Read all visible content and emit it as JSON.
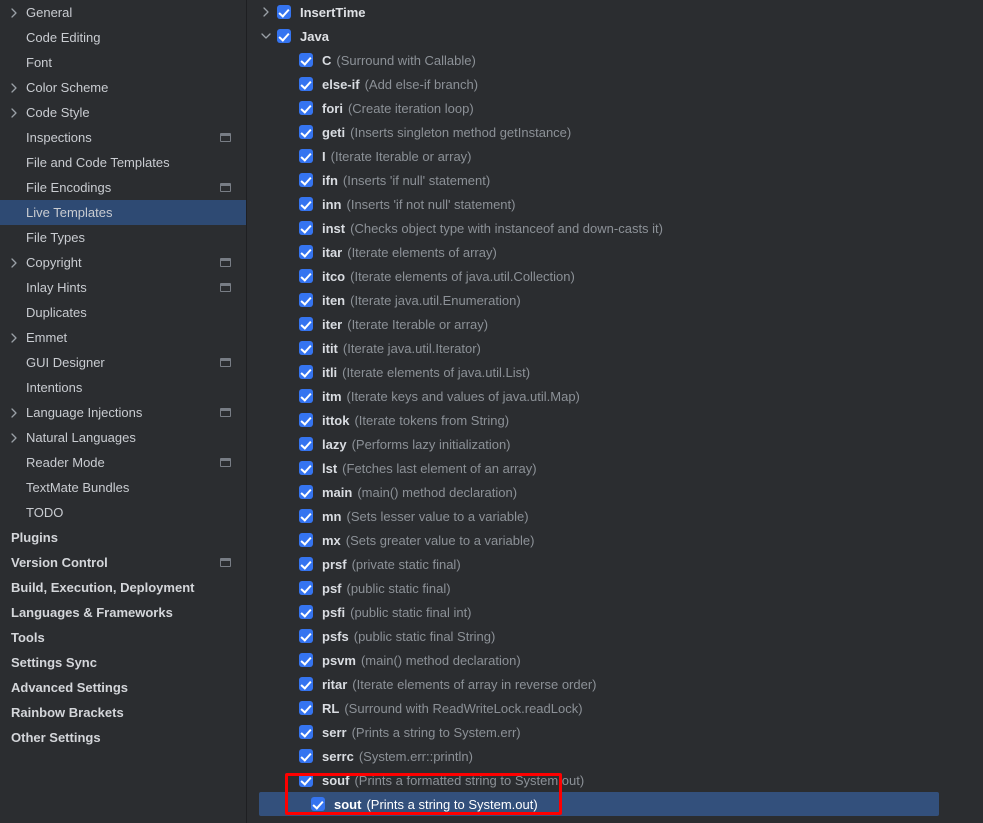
{
  "sidebar": {
    "items": [
      {
        "label": "General",
        "chevron": "right",
        "bold": false,
        "badge": false,
        "selected": false
      },
      {
        "label": "Code Editing",
        "chevron": "none",
        "bold": false,
        "badge": false,
        "selected": false
      },
      {
        "label": "Font",
        "chevron": "none",
        "bold": false,
        "badge": false,
        "selected": false
      },
      {
        "label": "Color Scheme",
        "chevron": "right",
        "bold": false,
        "badge": false,
        "selected": false
      },
      {
        "label": "Code Style",
        "chevron": "right",
        "bold": false,
        "badge": false,
        "selected": false
      },
      {
        "label": "Inspections",
        "chevron": "none",
        "bold": false,
        "badge": true,
        "selected": false
      },
      {
        "label": "File and Code Templates",
        "chevron": "none",
        "bold": false,
        "badge": false,
        "selected": false
      },
      {
        "label": "File Encodings",
        "chevron": "none",
        "bold": false,
        "badge": true,
        "selected": false
      },
      {
        "label": "Live Templates",
        "chevron": "none",
        "bold": false,
        "badge": false,
        "selected": true
      },
      {
        "label": "File Types",
        "chevron": "none",
        "bold": false,
        "badge": false,
        "selected": false
      },
      {
        "label": "Copyright",
        "chevron": "right",
        "bold": false,
        "badge": true,
        "selected": false
      },
      {
        "label": "Inlay Hints",
        "chevron": "none",
        "bold": false,
        "badge": true,
        "selected": false
      },
      {
        "label": "Duplicates",
        "chevron": "none",
        "bold": false,
        "badge": false,
        "selected": false
      },
      {
        "label": "Emmet",
        "chevron": "right",
        "bold": false,
        "badge": false,
        "selected": false
      },
      {
        "label": "GUI Designer",
        "chevron": "none",
        "bold": false,
        "badge": true,
        "selected": false
      },
      {
        "label": "Intentions",
        "chevron": "none",
        "bold": false,
        "badge": false,
        "selected": false
      },
      {
        "label": "Language Injections",
        "chevron": "right",
        "bold": false,
        "badge": true,
        "selected": false
      },
      {
        "label": "Natural Languages",
        "chevron": "right",
        "bold": false,
        "badge": false,
        "selected": false
      },
      {
        "label": "Reader Mode",
        "chevron": "none",
        "bold": false,
        "badge": true,
        "selected": false
      },
      {
        "label": "TextMate Bundles",
        "chevron": "none",
        "bold": false,
        "badge": false,
        "selected": false
      },
      {
        "label": "TODO",
        "chevron": "none",
        "bold": false,
        "badge": false,
        "selected": false
      },
      {
        "label": "Plugins",
        "chevron": "none",
        "bold": true,
        "badge": false,
        "selected": false
      },
      {
        "label": "Version Control",
        "chevron": "none",
        "bold": true,
        "badge": true,
        "selected": false
      },
      {
        "label": "Build, Execution, Deployment",
        "chevron": "none",
        "bold": true,
        "badge": false,
        "selected": false
      },
      {
        "label": "Languages & Frameworks",
        "chevron": "none",
        "bold": true,
        "badge": false,
        "selected": false
      },
      {
        "label": "Tools",
        "chevron": "none",
        "bold": true,
        "badge": false,
        "selected": false
      },
      {
        "label": "Settings Sync",
        "chevron": "none",
        "bold": true,
        "badge": false,
        "selected": false
      },
      {
        "label": "Advanced Settings",
        "chevron": "none",
        "bold": true,
        "badge": false,
        "selected": false
      },
      {
        "label": "Rainbow Brackets",
        "chevron": "none",
        "bold": true,
        "badge": false,
        "selected": false
      },
      {
        "label": "Other Settings",
        "chevron": "none",
        "bold": true,
        "badge": false,
        "selected": false
      }
    ]
  },
  "tree": {
    "rows": [
      {
        "level": "group",
        "chevron": "right",
        "checked": true,
        "label": "InsertTime",
        "desc": "",
        "selected": false
      },
      {
        "level": "group",
        "chevron": "down",
        "checked": true,
        "label": "Java",
        "desc": "",
        "selected": false
      },
      {
        "level": "child",
        "chevron": "none",
        "checked": true,
        "label": "C",
        "desc": "(Surround with Callable)",
        "selected": false
      },
      {
        "level": "child",
        "chevron": "none",
        "checked": true,
        "label": "else-if",
        "desc": "(Add else-if branch)",
        "selected": false
      },
      {
        "level": "child",
        "chevron": "none",
        "checked": true,
        "label": "fori",
        "desc": "(Create iteration loop)",
        "selected": false
      },
      {
        "level": "child",
        "chevron": "none",
        "checked": true,
        "label": "geti",
        "desc": "(Inserts singleton method getInstance)",
        "selected": false
      },
      {
        "level": "child",
        "chevron": "none",
        "checked": true,
        "label": "I",
        "desc": "(Iterate Iterable or array)",
        "selected": false
      },
      {
        "level": "child",
        "chevron": "none",
        "checked": true,
        "label": "ifn",
        "desc": "(Inserts 'if null' statement)",
        "selected": false
      },
      {
        "level": "child",
        "chevron": "none",
        "checked": true,
        "label": "inn",
        "desc": "(Inserts 'if not null' statement)",
        "selected": false
      },
      {
        "level": "child",
        "chevron": "none",
        "checked": true,
        "label": "inst",
        "desc": "(Checks object type with instanceof and down-casts it)",
        "selected": false
      },
      {
        "level": "child",
        "chevron": "none",
        "checked": true,
        "label": "itar",
        "desc": "(Iterate elements of array)",
        "selected": false
      },
      {
        "level": "child",
        "chevron": "none",
        "checked": true,
        "label": "itco",
        "desc": "(Iterate elements of java.util.Collection)",
        "selected": false
      },
      {
        "level": "child",
        "chevron": "none",
        "checked": true,
        "label": "iten",
        "desc": "(Iterate java.util.Enumeration)",
        "selected": false
      },
      {
        "level": "child",
        "chevron": "none",
        "checked": true,
        "label": "iter",
        "desc": "(Iterate Iterable or array)",
        "selected": false
      },
      {
        "level": "child",
        "chevron": "none",
        "checked": true,
        "label": "itit",
        "desc": "(Iterate java.util.Iterator)",
        "selected": false
      },
      {
        "level": "child",
        "chevron": "none",
        "checked": true,
        "label": "itli",
        "desc": "(Iterate elements of java.util.List)",
        "selected": false
      },
      {
        "level": "child",
        "chevron": "none",
        "checked": true,
        "label": "itm",
        "desc": "(Iterate keys and values of java.util.Map)",
        "selected": false
      },
      {
        "level": "child",
        "chevron": "none",
        "checked": true,
        "label": "ittok",
        "desc": "(Iterate tokens from String)",
        "selected": false
      },
      {
        "level": "child",
        "chevron": "none",
        "checked": true,
        "label": "lazy",
        "desc": "(Performs lazy initialization)",
        "selected": false
      },
      {
        "level": "child",
        "chevron": "none",
        "checked": true,
        "label": "lst",
        "desc": "(Fetches last element of an array)",
        "selected": false
      },
      {
        "level": "child",
        "chevron": "none",
        "checked": true,
        "label": "main",
        "desc": "(main() method declaration)",
        "selected": false
      },
      {
        "level": "child",
        "chevron": "none",
        "checked": true,
        "label": "mn",
        "desc": "(Sets lesser value to a variable)",
        "selected": false
      },
      {
        "level": "child",
        "chevron": "none",
        "checked": true,
        "label": "mx",
        "desc": "(Sets greater value to a variable)",
        "selected": false
      },
      {
        "level": "child",
        "chevron": "none",
        "checked": true,
        "label": "prsf",
        "desc": "(private static final)",
        "selected": false
      },
      {
        "level": "child",
        "chevron": "none",
        "checked": true,
        "label": "psf",
        "desc": "(public static final)",
        "selected": false
      },
      {
        "level": "child",
        "chevron": "none",
        "checked": true,
        "label": "psfi",
        "desc": "(public static final int)",
        "selected": false
      },
      {
        "level": "child",
        "chevron": "none",
        "checked": true,
        "label": "psfs",
        "desc": "(public static final String)",
        "selected": false
      },
      {
        "level": "child",
        "chevron": "none",
        "checked": true,
        "label": "psvm",
        "desc": "(main() method declaration)",
        "selected": false
      },
      {
        "level": "child",
        "chevron": "none",
        "checked": true,
        "label": "ritar",
        "desc": "(Iterate elements of array in reverse order)",
        "selected": false
      },
      {
        "level": "child",
        "chevron": "none",
        "checked": true,
        "label": "RL",
        "desc": "(Surround with ReadWriteLock.readLock)",
        "selected": false
      },
      {
        "level": "child",
        "chevron": "none",
        "checked": true,
        "label": "serr",
        "desc": "(Prints a string to System.err)",
        "selected": false
      },
      {
        "level": "child",
        "chevron": "none",
        "checked": true,
        "label": "serrc",
        "desc": "(System.err::println)",
        "selected": false
      },
      {
        "level": "child",
        "chevron": "none",
        "checked": true,
        "label": "souf",
        "desc": "(Prints a formatted string to System.out)",
        "selected": false
      },
      {
        "level": "child",
        "chevron": "none",
        "checked": true,
        "label": "sout",
        "desc": "(Prints a string to System.out)",
        "selected": true
      }
    ]
  },
  "annotation": {
    "shape": "rectangle",
    "color": "#ff0000"
  },
  "colors": {
    "background": "#2b2d30",
    "sidebar_selected": "#2e4a73",
    "row_selected": "#33507c",
    "checkbox": "#3574f0",
    "label_text": "#d9dce1",
    "desc_text": "#8c9197",
    "scrollbar": "#5a5d63"
  }
}
